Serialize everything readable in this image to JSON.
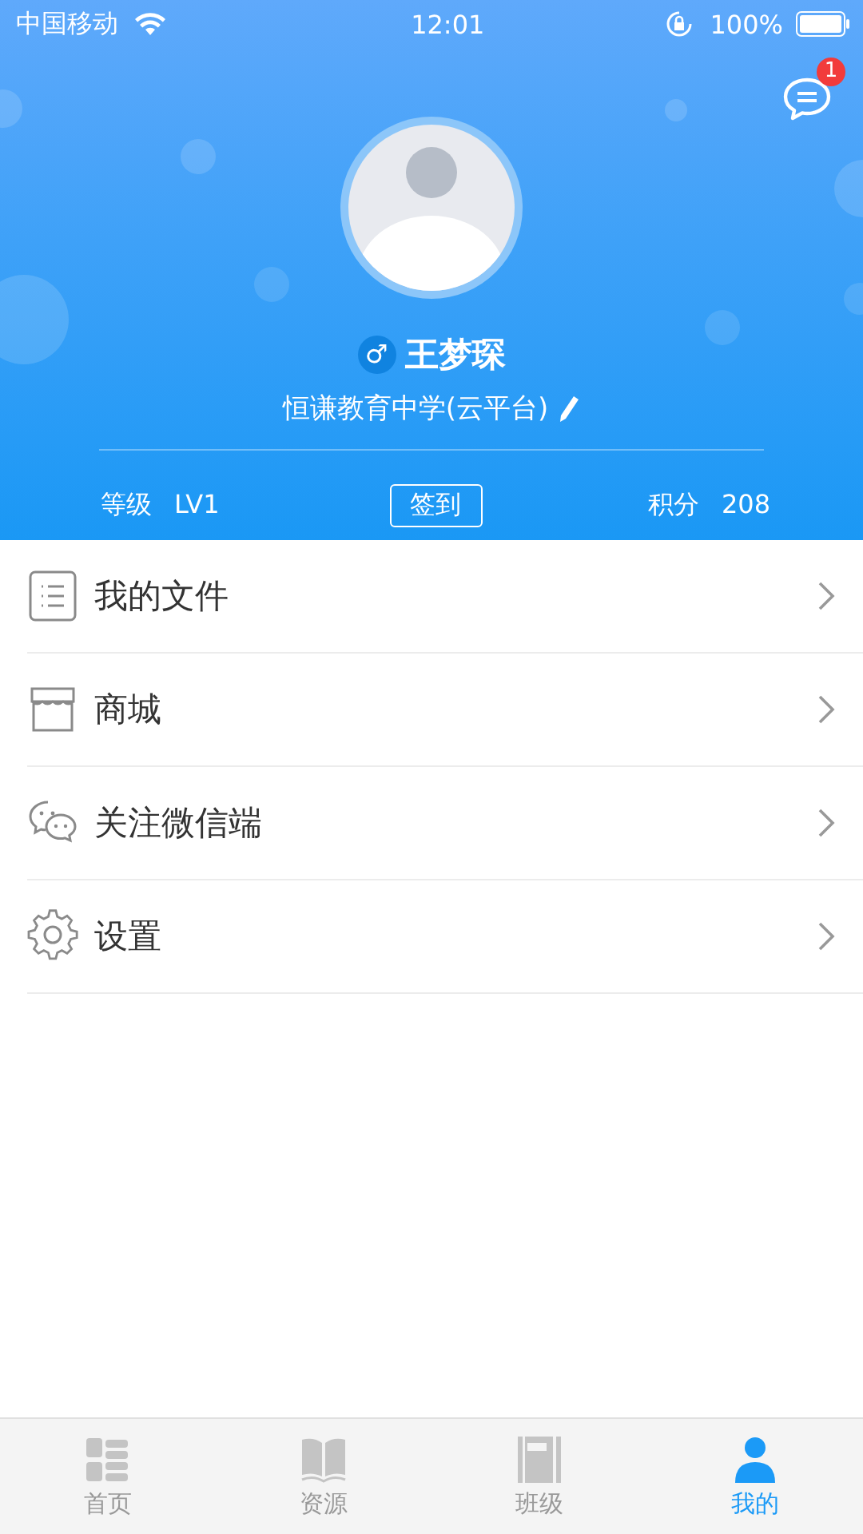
{
  "status_bar": {
    "carrier": "中国移动",
    "time": "12:01",
    "battery": "100%"
  },
  "messages": {
    "badge": "1"
  },
  "profile": {
    "gender": "♂",
    "name": "王梦琛",
    "school": "恒谦教育中学(云平台)",
    "level_label": "等级",
    "level_value": "LV1",
    "checkin": "签到",
    "points_label": "积分",
    "points_value": "208"
  },
  "menu": [
    {
      "kind": "files",
      "label": "我的文件"
    },
    {
      "kind": "shop",
      "label": "商城"
    },
    {
      "kind": "wechat",
      "label": "关注微信端"
    },
    {
      "kind": "settings",
      "label": "设置"
    }
  ],
  "tabs": [
    {
      "kind": "home",
      "label": "首页",
      "selected": false
    },
    {
      "kind": "resources",
      "label": "资源",
      "selected": false
    },
    {
      "kind": "class",
      "label": "班级",
      "selected": false
    },
    {
      "kind": "me",
      "label": "我的",
      "selected": true
    }
  ]
}
